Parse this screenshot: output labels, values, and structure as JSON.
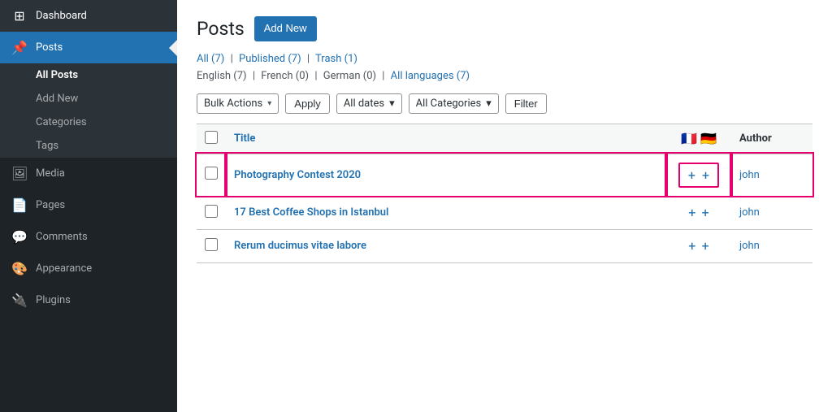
{
  "sidebar": {
    "items": [
      {
        "id": "dashboard",
        "label": "Dashboard",
        "icon": "⊞",
        "active": false
      },
      {
        "id": "posts",
        "label": "Posts",
        "icon": "📌",
        "active": true
      },
      {
        "id": "media",
        "label": "Media",
        "icon": "🖼",
        "active": false
      },
      {
        "id": "pages",
        "label": "Pages",
        "icon": "📄",
        "active": false
      },
      {
        "id": "comments",
        "label": "Comments",
        "icon": "💬",
        "active": false
      },
      {
        "id": "appearance",
        "label": "Appearance",
        "icon": "🎨",
        "active": false
      },
      {
        "id": "plugins",
        "label": "Plugins",
        "icon": "🔌",
        "active": false
      }
    ],
    "submenu": {
      "posts": [
        {
          "id": "all-posts",
          "label": "All Posts",
          "active": true
        },
        {
          "id": "add-new",
          "label": "Add New",
          "active": false
        },
        {
          "id": "categories",
          "label": "Categories",
          "active": false
        },
        {
          "id": "tags",
          "label": "Tags",
          "active": false
        }
      ]
    }
  },
  "page": {
    "title": "Posts",
    "add_new_label": "Add New"
  },
  "filter_links": {
    "all_label": "All",
    "all_count": "(7)",
    "published_label": "Published",
    "published_count": "(7)",
    "trash_label": "Trash",
    "trash_count": "(1)"
  },
  "lang_links": {
    "english": "English (7)",
    "french": "French (0)",
    "german": "German (0)",
    "all": "All languages (7)"
  },
  "toolbar": {
    "bulk_actions_label": "Bulk Actions",
    "apply_label": "Apply",
    "date_label": "All dates",
    "category_label": "All Categories",
    "filter_label": "Filter"
  },
  "table": {
    "columns": {
      "title": "Title",
      "author": "Author"
    },
    "rows": [
      {
        "id": 1,
        "title": "Photography Contest 2020",
        "author": "john",
        "highlighted": true
      },
      {
        "id": 2,
        "title": "17 Best Coffee Shops in Istanbul",
        "author": "john",
        "highlighted": false
      },
      {
        "id": 3,
        "title": "Rerum ducimus vitae labore",
        "author": "john",
        "highlighted": false
      }
    ]
  },
  "colors": {
    "accent_blue": "#2271b1",
    "highlight_pink": "#e6006e",
    "sidebar_active": "#2271b1",
    "sidebar_bg": "#1d2327"
  }
}
